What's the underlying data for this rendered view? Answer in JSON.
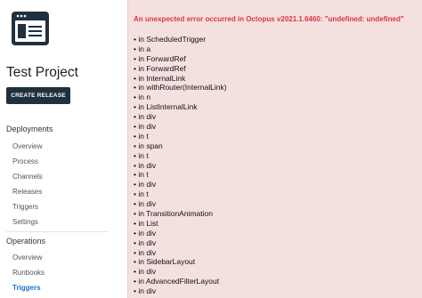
{
  "sidebar": {
    "project_title": "Test Project",
    "create_release_label": "CREATE RELEASE",
    "sections": [
      {
        "title": "Deployments",
        "items": [
          "Overview",
          "Process",
          "Channels",
          "Releases",
          "Triggers",
          "Settings"
        ]
      },
      {
        "title": "Operations",
        "items": [
          "Overview",
          "Runbooks",
          "Triggers"
        ]
      }
    ],
    "active_item": "Operations > Triggers"
  },
  "error": {
    "title": "An unexpected error occurred in Octopus v2021.1.6460: \"undefined: undefined\"",
    "stack": [
      "• in ScheduledTrigger",
      "• in a",
      "• in ForwardRef",
      "• in ForwardRef",
      "• in InternalLink",
      "• in withRouter(InternalLink)",
      "• in n",
      "• in ListInternalLink",
      "• in div",
      "• in div",
      "• in t",
      "• in span",
      "• in t",
      "• in div",
      "• in t",
      "• in div",
      "• in t",
      "• in div",
      "• in TransitionAnimation",
      "• in List",
      "• in div",
      "• in div",
      "• in div",
      "• in SidebarLayout",
      "• in div",
      "• in AdvancedFilterLayout",
      "• in div",
      "• in div"
    ]
  },
  "colors": {
    "button_bg": "#1f303f",
    "active_link": "#1a73c9",
    "error_title": "#d9363e",
    "error_panel_bg": "#f5e0e0"
  }
}
